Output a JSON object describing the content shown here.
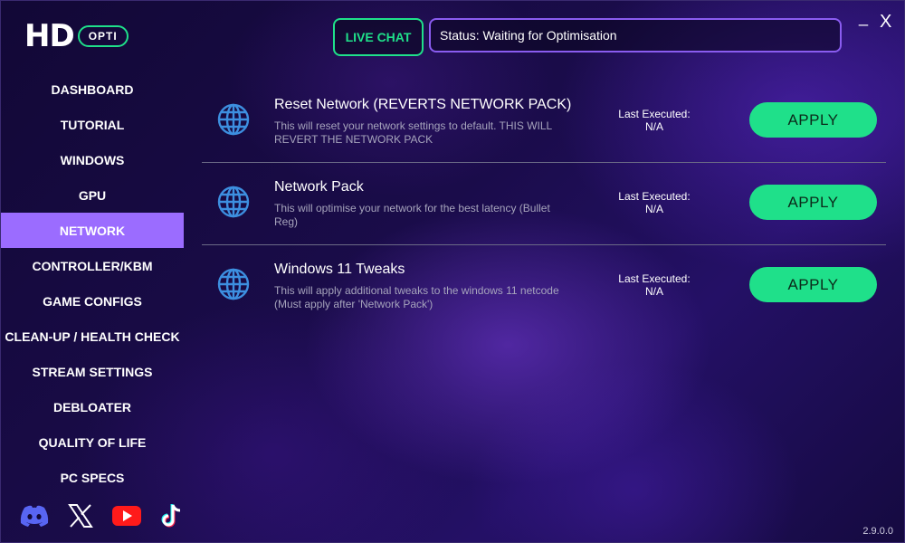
{
  "logo": {
    "primary": "HD",
    "badge": "OPTI"
  },
  "header": {
    "live_chat_label": "LIVE CHAT",
    "status_text": "Status: Waiting for Optimisation",
    "minimize_label": "_",
    "close_label": "X"
  },
  "sidebar": {
    "items": [
      {
        "label": "DASHBOARD",
        "active": false
      },
      {
        "label": "TUTORIAL",
        "active": false
      },
      {
        "label": "WINDOWS",
        "active": false
      },
      {
        "label": "GPU",
        "active": false
      },
      {
        "label": "NETWORK",
        "active": true
      },
      {
        "label": "CONTROLLER/KBM",
        "active": false
      },
      {
        "label": "GAME CONFIGS",
        "active": false
      },
      {
        "label": "CLEAN-UP / HEALTH CHECK",
        "active": false
      },
      {
        "label": "STREAM SETTINGS",
        "active": false
      },
      {
        "label": "DEBLOATER",
        "active": false
      },
      {
        "label": "QUALITY OF LIFE",
        "active": false
      },
      {
        "label": "PC SPECS",
        "active": false
      }
    ],
    "socials": [
      "discord-icon",
      "x-icon",
      "youtube-icon",
      "tiktok-icon"
    ]
  },
  "tweaks": [
    {
      "title": "Reset Network (REVERTS NETWORK PACK)",
      "description": "This will reset your network settings to default. THIS WILL REVERT THE NETWORK PACK",
      "last_executed_label": "Last Executed:",
      "last_executed_value": "N/A",
      "button_label": "APPLY",
      "icon": "globe-icon"
    },
    {
      "title": "Network Pack",
      "description": "This will optimise your network for the best latency (Bullet Reg)",
      "last_executed_label": "Last Executed:",
      "last_executed_value": "N/A",
      "button_label": "APPLY",
      "icon": "globe-icon"
    },
    {
      "title": "Windows 11 Tweaks",
      "description": "This will apply additional tweaks to the windows 11 netcode (Must apply after 'Network Pack')",
      "last_executed_label": "Last Executed:",
      "last_executed_value": "N/A",
      "button_label": "APPLY",
      "icon": "globe-icon"
    }
  ],
  "version": "2.9.0.0",
  "colors": {
    "accent_green": "#1fe08a",
    "accent_purple": "#9b6cff",
    "status_border": "#8a5cf0",
    "globe_blue": "#3d8fe0"
  }
}
